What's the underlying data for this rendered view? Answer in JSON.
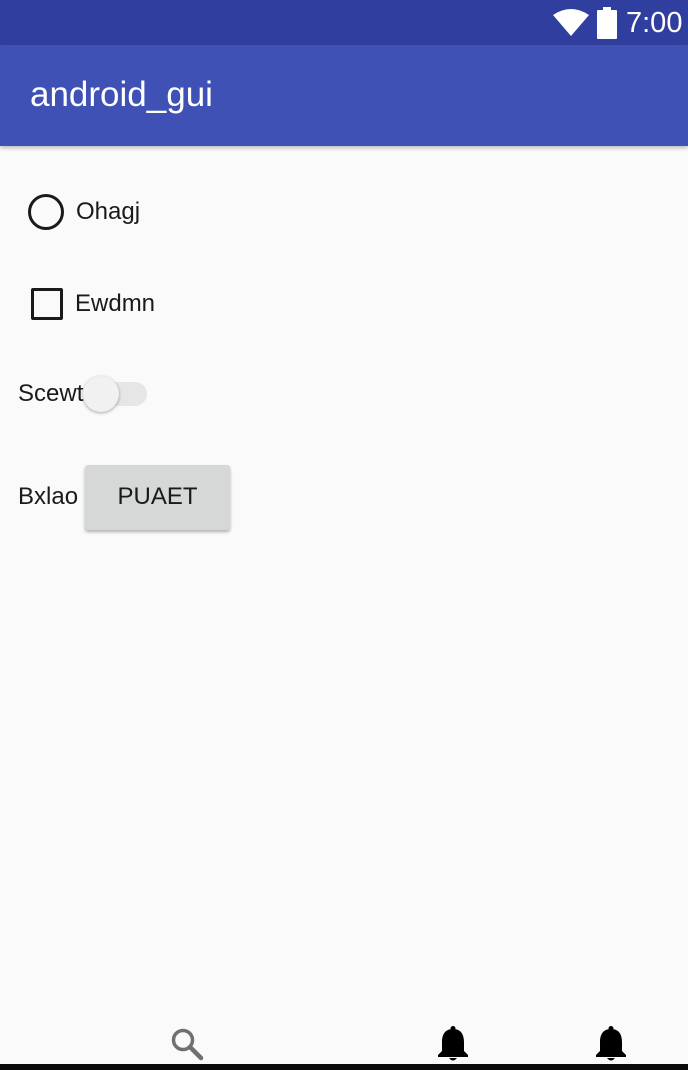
{
  "status_bar": {
    "time": "7:00",
    "icons": [
      "wifi-icon",
      "battery-icon"
    ],
    "background": "#303f9f"
  },
  "app_bar": {
    "title": "android_gui",
    "background": "#3f51b5"
  },
  "form": {
    "radio": {
      "label": "Ohagj",
      "checked": false
    },
    "checkbox": {
      "label": "Ewdmn",
      "checked": false
    },
    "switch": {
      "label": "Scewt",
      "on": false
    },
    "button_row": {
      "label": "Bxlao",
      "button_label": "PUAET"
    }
  },
  "bottom_bar": {
    "icons": [
      "search-icon",
      "bell-icon",
      "bell-icon"
    ]
  }
}
